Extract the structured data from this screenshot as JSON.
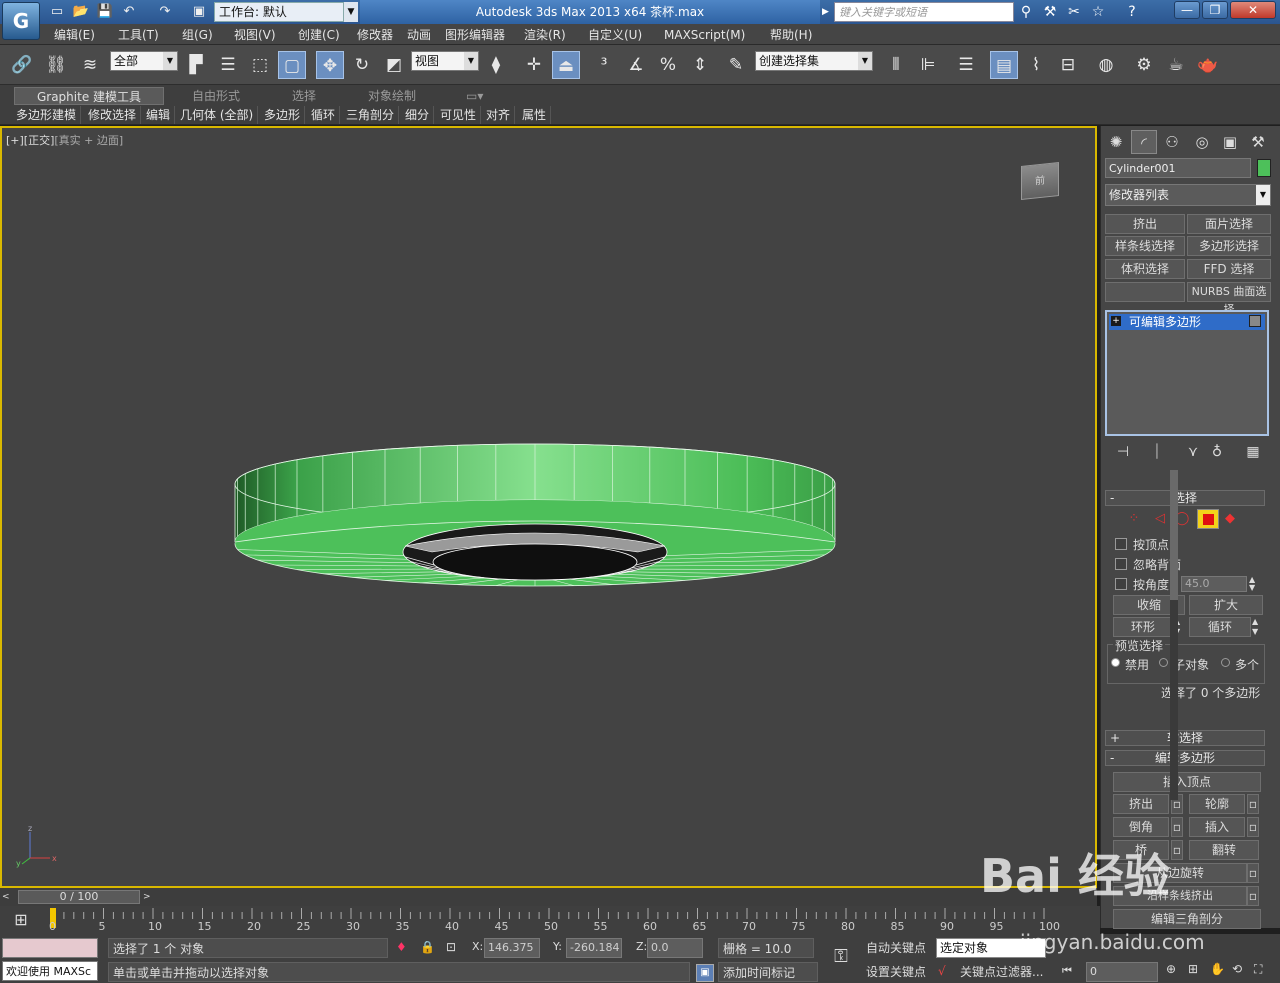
{
  "title_bar": {
    "workspace_label": "工作台: 默认",
    "title": "Autodesk 3ds Max  2013 x64      茶杯.max",
    "search_placeholder": "键入关键字或短语",
    "window_controls": {
      "minimize": "—",
      "restore": "❐",
      "close": "✕"
    }
  },
  "menu": [
    "编辑(E)",
    "工具(T)",
    "组(G)",
    "视图(V)",
    "创建(C)",
    "修改器",
    "动画",
    "图形编辑器",
    "渲染(R)",
    "自定义(U)",
    "MAXScript(M)",
    "帮助(H)"
  ],
  "toolbar": {
    "filter_value": "全部",
    "reference_coord": "视图",
    "named_selection": "创建选择集"
  },
  "ribbon": {
    "tabs": [
      "Graphite 建模工具",
      "自由形式",
      "选择",
      "对象绘制"
    ],
    "subtabs": [
      "多边形建模",
      "修改选择",
      "编辑",
      "几何体 (全部)",
      "多边形",
      "循环",
      "三角剖分",
      "细分",
      "可见性",
      "对齐",
      "属性"
    ]
  },
  "viewport": {
    "label_bracket": "[+][正交]",
    "label_shading": "[真实 + 边面]",
    "viewcube_label": "前",
    "mesh_color": "#4dc05a"
  },
  "command_panel": {
    "object_name": "Cylinder001",
    "object_color": "#4dc05a",
    "modifier_list": "修改器列表",
    "modifier_buttons": [
      "挤出",
      "面片选择",
      "样条线选择",
      "多边形选择",
      "体积选择",
      "FFD 选择",
      "",
      "NURBS 曲面选择"
    ],
    "stack_item": "可编辑多边形",
    "selection_rollout": {
      "title": "选择",
      "by_vertex": "按顶点",
      "ignore_backfacing": "忽略背面",
      "by_angle": "按角度:",
      "angle_value": "45.0",
      "shrink": "收缩",
      "grow": "扩大",
      "ring": "环形",
      "loop": "循环",
      "preview_title": "预览选择",
      "preview_off": "禁用",
      "preview_subobj": "子对象",
      "preview_multi": "多个",
      "status": "选择了 0 个多边形"
    },
    "soft_selection": "软选择",
    "edit_poly": {
      "title": "编辑多边形",
      "insert_vertex": "插入顶点",
      "extrude": "挤出",
      "outline": "轮廓",
      "bevel": "倒角",
      "inset": "插入",
      "bridge": "桥",
      "flip": "翻转",
      "hinge": "从边旋转",
      "extrude_along_spline": "沿样条线挤出",
      "edit_triangulation": "编辑三角剖分"
    }
  },
  "timeline": {
    "slider_label": "0 / 100",
    "ticks": [
      "0",
      "5",
      "10",
      "15",
      "20",
      "25",
      "30",
      "35",
      "40",
      "45",
      "50",
      "55",
      "60",
      "65",
      "70",
      "75",
      "80",
      "85",
      "90",
      "95",
      "100"
    ]
  },
  "status": {
    "welcome": "欢迎使用 MAXSc",
    "selected": "选择了 1 个 对象",
    "prompt": "单击或单击并拖动以选择对象",
    "x_label": "X:",
    "x_value": "146.375",
    "y_label": "Y:",
    "y_value": "-260.184",
    "z_label": "Z:",
    "z_value": "0.0",
    "grid": "栅格 = 10.0",
    "auto_key": "自动关键点",
    "set_key": "设置关键点",
    "selected_object": "选定对象",
    "key_filters": "关键点过滤器...",
    "add_time_tag": "添加时间标记",
    "frame_value": "0"
  },
  "watermark": {
    "brand": "Bai 经验",
    "url": "jingyan.baidu.com"
  }
}
